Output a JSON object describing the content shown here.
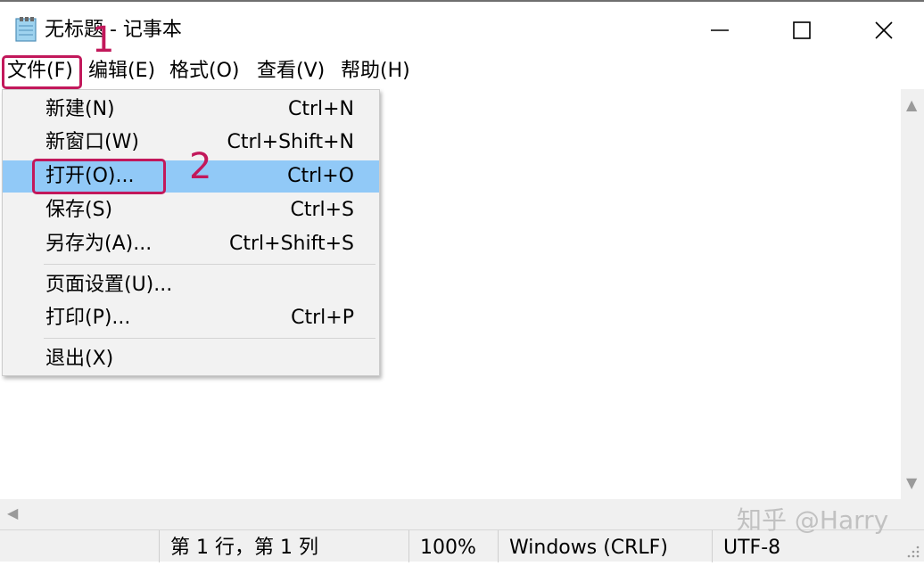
{
  "window": {
    "title": "无标题 - 记事本",
    "minimize_label": "—",
    "maximize_label": "☐",
    "close_label": "✕"
  },
  "menubar": {
    "file": "文件(F)",
    "edit": "编辑(E)",
    "format": "格式(O)",
    "view": "查看(V)",
    "help": "帮助(H)"
  },
  "file_menu": {
    "items": [
      {
        "label": "新建(N)",
        "shortcut": "Ctrl+N"
      },
      {
        "label": "新窗口(W)",
        "shortcut": "Ctrl+Shift+N"
      },
      {
        "label": "打开(O)...",
        "shortcut": "Ctrl+O"
      },
      {
        "label": "保存(S)",
        "shortcut": "Ctrl+S"
      },
      {
        "label": "另存为(A)...",
        "shortcut": "Ctrl+Shift+S"
      },
      {
        "label": "页面设置(U)...",
        "shortcut": ""
      },
      {
        "label": "打印(P)...",
        "shortcut": "Ctrl+P"
      },
      {
        "label": "退出(X)",
        "shortcut": ""
      }
    ],
    "highlighted_index": 2
  },
  "statusbar": {
    "position": "第 1 行，第 1 列",
    "zoom": "100%",
    "line_ending": "Windows (CRLF)",
    "encoding": "UTF-8"
  },
  "annotations": {
    "step1": "1",
    "step2": "2",
    "color": "#c2185b"
  },
  "watermark": "知乎 @Harry",
  "icons": {
    "app": "notepad-icon",
    "minimize": "minimize-icon",
    "maximize": "maximize-icon",
    "close": "close-icon"
  },
  "colors": {
    "menu_highlight": "#91c9f7",
    "menu_bg": "#f2f2f2",
    "status_bg": "#f0f0f0"
  }
}
